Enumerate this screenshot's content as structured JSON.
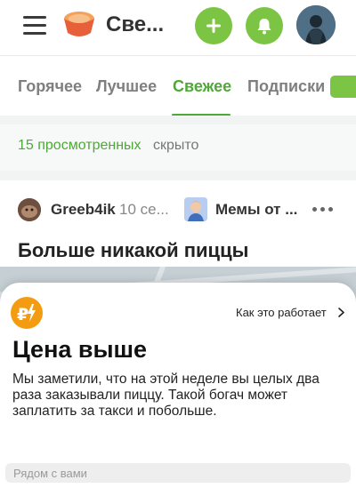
{
  "header": {
    "title": "Све...",
    "menu_icon": "menu-icon",
    "logo_icon": "app-logo-icon",
    "add_icon": "plus-icon",
    "bell_icon": "bell-icon",
    "accent_color": "#7cc443"
  },
  "tabs": {
    "items": [
      "Горячее",
      "Лучшее",
      "Свежее",
      "Подписки"
    ],
    "active": "Свежее",
    "active_color": "#4ea937"
  },
  "hidden_note": {
    "count_label": "15 просмотренных",
    "suffix": "скрыто"
  },
  "post": {
    "author": "Greeb4ik",
    "time": "10 се...",
    "community": "Мемы от ...",
    "title": "Больше никакой пиццы"
  },
  "sheet": {
    "how_label": "Как это работает",
    "title": "Цена выше",
    "description": "Мы заметили, что на этой неделе вы целых два раза заказывали пиццу. Такой богач может заплатить за такси и побольше.",
    "nearby_label": "Рядом с вами",
    "badge_color": "#f39c12"
  }
}
